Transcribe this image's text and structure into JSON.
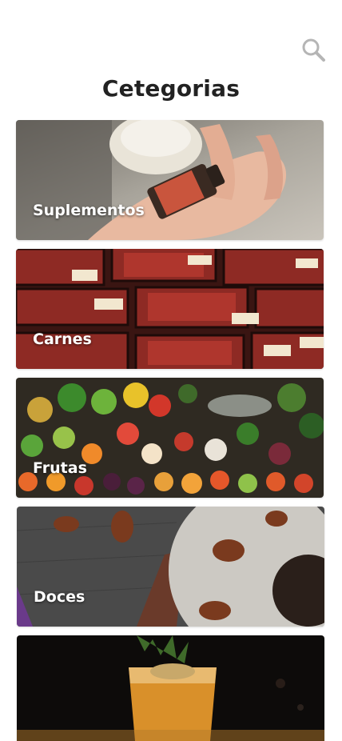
{
  "header": {
    "title": "Cetegorias",
    "search_icon": "search-icon"
  },
  "categories": [
    {
      "label": "Suplementos",
      "image": "supplement-bottle-in-hand"
    },
    {
      "label": "Carnes",
      "image": "packaged-meat-trays"
    },
    {
      "label": "Frutas",
      "image": "fruit-and-vegetable-market"
    },
    {
      "label": "Doces",
      "image": "cake-with-pecans"
    },
    {
      "label": "",
      "image": "cocktail-drink"
    }
  ],
  "colors": {
    "title": "#222222",
    "search_icon": "#b5b5b5",
    "label_text": "#ffffff"
  }
}
